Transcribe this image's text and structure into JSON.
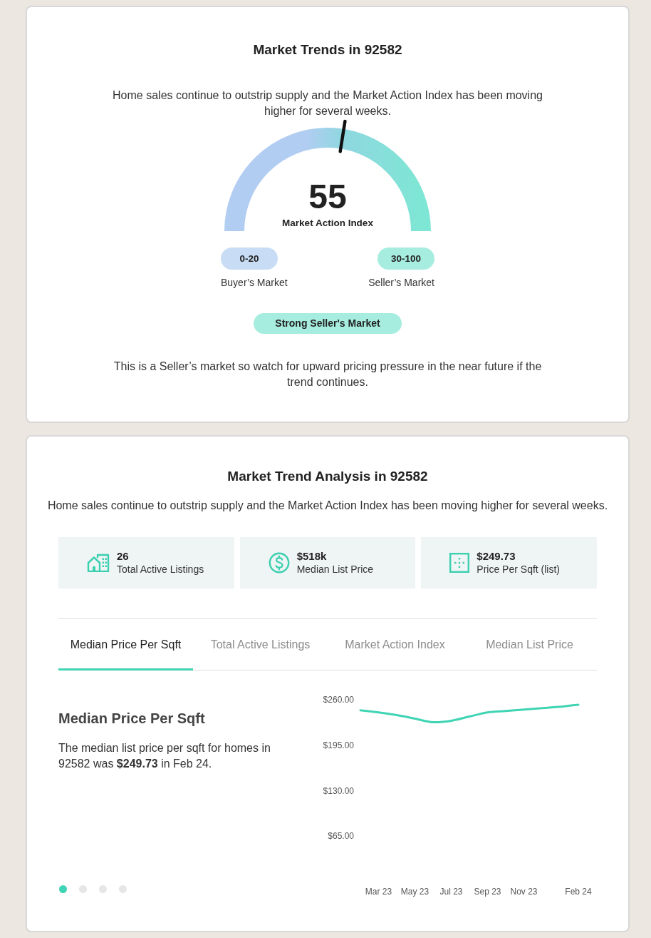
{
  "market_trends": {
    "title": "Market Trends in 92582",
    "summary": "Home sales continue to outstrip supply and the Market Action Index has been moving higher for several weeks.",
    "gauge": {
      "value": "55",
      "label": "Market Action Index",
      "level": 0.55
    },
    "ranges": [
      {
        "range": "0-20",
        "label": "Buyer’s Market",
        "color": "#c8ddf5"
      },
      {
        "range": "30-100",
        "label": "Seller’s Market",
        "color": "#a6ede0"
      }
    ],
    "status": "Strong Seller's Market",
    "note": "This is a Seller’s market so watch for upward pricing pressure in the near future if the trend continues."
  },
  "trend_analysis": {
    "title": "Market Trend Analysis in 92582",
    "summary": "Home sales continue to outstrip supply and the Market Action Index has been moving higher for several weeks.",
    "stats": [
      {
        "kind": "listings",
        "value": "26",
        "label": "Total Active Listings"
      },
      {
        "kind": "price",
        "value": "$518k",
        "label": "Median List Price"
      },
      {
        "kind": "sqft",
        "value": "$249.73",
        "label": "Price Per Sqft (list)"
      }
    ],
    "tabs": [
      {
        "label": "Median Price Per Sqft",
        "selected": true
      },
      {
        "label": "Total Active Listings",
        "selected": false
      },
      {
        "label": "Market Action Index",
        "selected": false
      },
      {
        "label": "Median List Price",
        "selected": false
      }
    ],
    "panel": {
      "heading": "Median Price Per Sqft",
      "text": "The median list price per sqft for homes in 92582 was **$249.73** in Feb 24.",
      "chart_data": {
        "type": "line",
        "categories": [
          null,
          "Mar 23",
          null,
          "May 23",
          null,
          "Jul 23",
          null,
          "Sep 23",
          null,
          "Nov 23",
          null,
          null,
          "Feb 24"
        ],
        "ylim": [
          65,
          260
        ],
        "yticks": [
          {
            "value": 65,
            "label": "$65.00"
          },
          {
            "value": 130,
            "label": "$130.00"
          },
          {
            "value": 195,
            "label": "$195.00"
          },
          {
            "value": 260,
            "label": "$260.00"
          }
        ],
        "series": [
          {
            "color": "#3fd4b4",
            "values": [
              245,
              242,
              238,
              233,
              228,
              230,
              236,
              242,
              244,
              246,
              248,
              250,
              253
            ]
          }
        ]
      }
    },
    "pager": [
      {
        "selected": true
      },
      {
        "selected": false
      },
      {
        "selected": false
      },
      {
        "selected": false
      }
    ]
  }
}
